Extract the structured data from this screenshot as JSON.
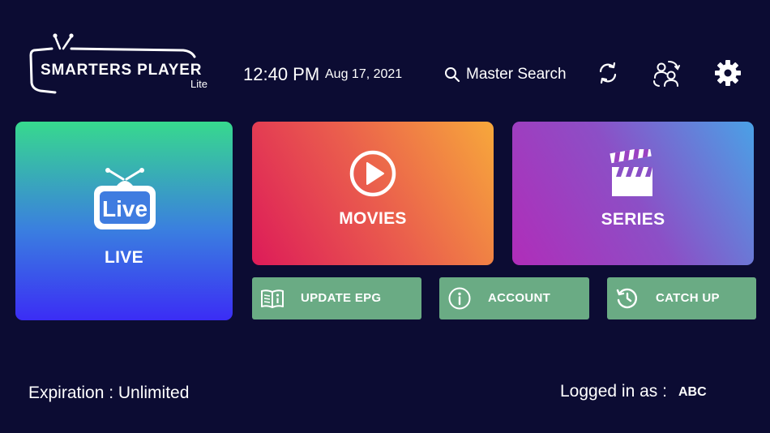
{
  "header": {
    "logo_title": "SMARTERS PLAYER",
    "logo_subtitle": "Lite",
    "time": "12:40 PM",
    "date": "Aug 17, 2021",
    "search_label": "Master Search",
    "icons": [
      "search-icon",
      "refresh-icon",
      "switch-user-icon",
      "gear-icon"
    ]
  },
  "tiles": {
    "live": {
      "label": "LIVE",
      "icon": "live-tv-icon",
      "badge_text": "Live"
    },
    "movies": {
      "label": "MOVIES",
      "icon": "play-icon"
    },
    "series": {
      "label": "SERIES",
      "icon": "clapperboard-icon"
    }
  },
  "buttons": {
    "update_epg": {
      "label": "UPDATE EPG",
      "icon": "book-info-icon"
    },
    "account": {
      "label": "ACCOUNT",
      "icon": "info-icon"
    },
    "catch_up": {
      "label": "CATCH UP",
      "icon": "history-icon"
    }
  },
  "footer": {
    "expiration": "Expiration : Unlimited",
    "logged_in_label": "Logged in as :",
    "username": "ABC"
  },
  "colors": {
    "background": "#0c0c33",
    "button_green": "#6aab84",
    "live_gradient": [
      "#37d98e",
      "#3b2df5"
    ],
    "movies_gradient": [
      "#dd1b59",
      "#f7a83b"
    ],
    "series_gradient": [
      "#b02db9",
      "#4aa1e6"
    ]
  }
}
